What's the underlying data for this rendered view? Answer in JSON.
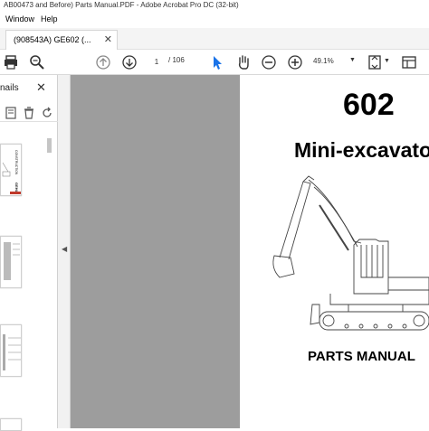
{
  "window": {
    "title": "AB00473 and Before) Parts Manual.PDF - Adobe Acrobat Pro DC (32-bit)"
  },
  "menu": {
    "items": [
      "Window",
      "Help"
    ]
  },
  "tabs": {
    "active_label": "(908543A) GE602 (...",
    "close_symbol": "✕"
  },
  "toolbar": {
    "current_page": "1",
    "page_separator": "/ 106",
    "zoom_value": "49.1%"
  },
  "panel": {
    "title": "nails",
    "close_symbol": "✕"
  },
  "document": {
    "model_number": "602",
    "product_name": "Mini-excavator",
    "footer": "PARTS MANUAL",
    "thumbnail_side_text": "CONSTRUCTION",
    "thumbnail_brand": "GEHL"
  },
  "colors": {
    "doc_background": "#9d9d9d",
    "accent": "#1a73e8"
  }
}
